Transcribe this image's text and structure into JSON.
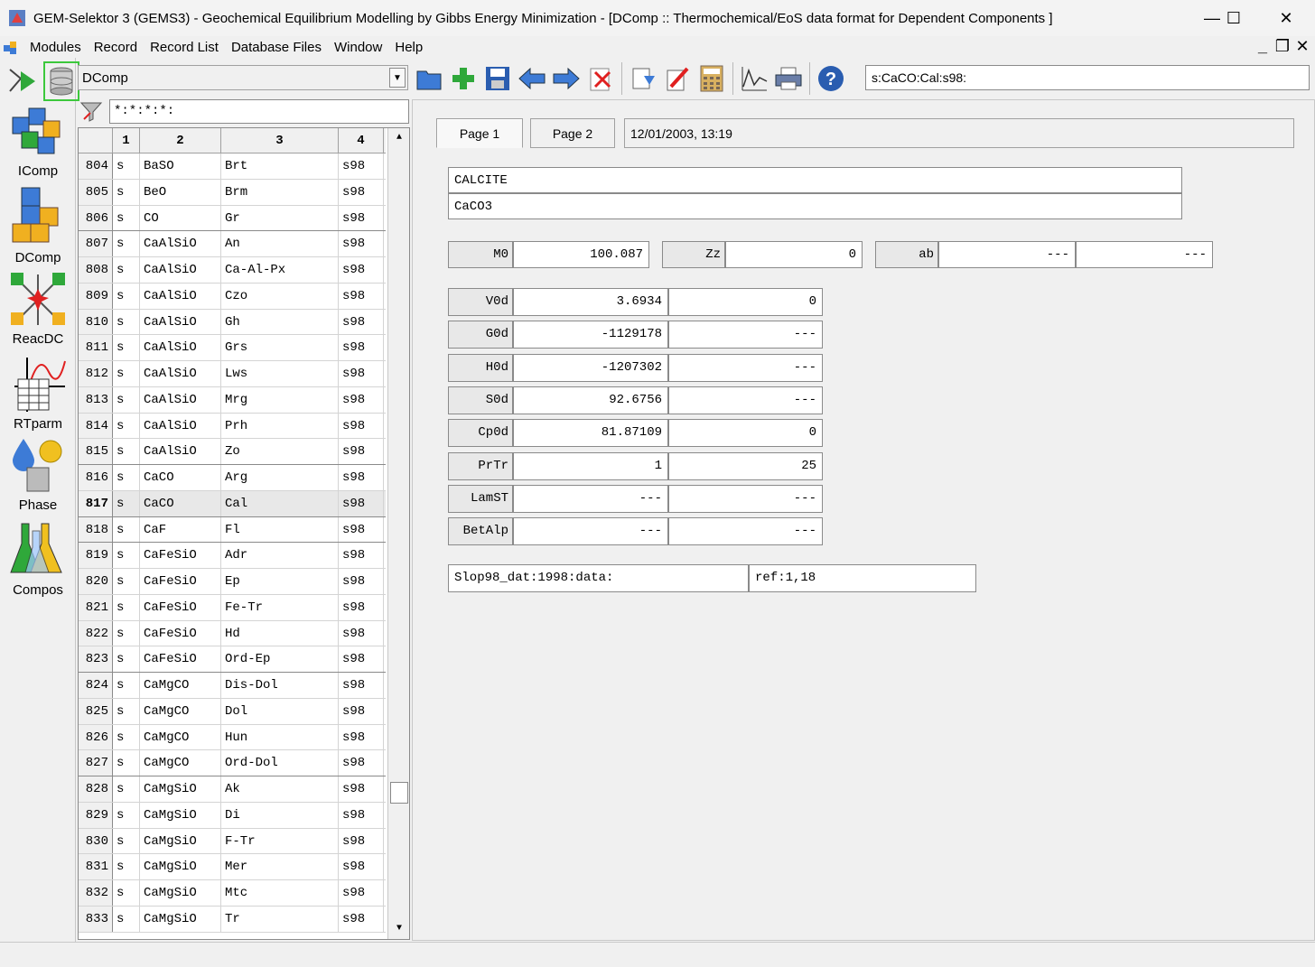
{
  "window": {
    "title": "GEM-Selektor 3 (GEMS3) - Geochemical Equilibrium Modelling by Gibbs Energy Minimization - [DComp ::  Thermochemical/EoS data format for Dependent Components ]",
    "minimize": "—",
    "maximize": "☐",
    "close": "✕"
  },
  "menu": [
    "Modules",
    "Record",
    "Record List",
    "Database Files",
    "Window",
    "Help"
  ],
  "modules": [
    {
      "label": "IComp"
    },
    {
      "label": "DComp"
    },
    {
      "label": "ReacDC"
    },
    {
      "label": "RTparm"
    },
    {
      "label": "Phase"
    },
    {
      "label": "Compos"
    }
  ],
  "module_selector": {
    "value": "DComp"
  },
  "filter": {
    "value": "*:*:*:*:"
  },
  "record_key": "s:CaCO:Cal:s98:",
  "table": {
    "headers": [
      "1",
      "2",
      "3",
      "4"
    ],
    "selected_index": "817",
    "rows": [
      {
        "n": "804",
        "c1": "s",
        "c2": "BaSO",
        "c3": "Brt",
        "c4": "s98"
      },
      {
        "n": "805",
        "c1": "s",
        "c2": "BeO",
        "c3": "Brm",
        "c4": "s98"
      },
      {
        "n": "806",
        "c1": "s",
        "c2": "CO",
        "c3": "Gr",
        "c4": "s98"
      },
      {
        "n": "807",
        "c1": "s",
        "c2": "CaAlSiO",
        "c3": "An",
        "c4": "s98"
      },
      {
        "n": "808",
        "c1": "s",
        "c2": "CaAlSiO",
        "c3": "Ca-Al-Px",
        "c4": "s98"
      },
      {
        "n": "809",
        "c1": "s",
        "c2": "CaAlSiO",
        "c3": "Czo",
        "c4": "s98"
      },
      {
        "n": "810",
        "c1": "s",
        "c2": "CaAlSiO",
        "c3": "Gh",
        "c4": "s98"
      },
      {
        "n": "811",
        "c1": "s",
        "c2": "CaAlSiO",
        "c3": "Grs",
        "c4": "s98"
      },
      {
        "n": "812",
        "c1": "s",
        "c2": "CaAlSiO",
        "c3": "Lws",
        "c4": "s98"
      },
      {
        "n": "813",
        "c1": "s",
        "c2": "CaAlSiO",
        "c3": "Mrg",
        "c4": "s98"
      },
      {
        "n": "814",
        "c1": "s",
        "c2": "CaAlSiO",
        "c3": "Prh",
        "c4": "s98"
      },
      {
        "n": "815",
        "c1": "s",
        "c2": "CaAlSiO",
        "c3": "Zo",
        "c4": "s98"
      },
      {
        "n": "816",
        "c1": "s",
        "c2": "CaCO",
        "c3": "Arg",
        "c4": "s98"
      },
      {
        "n": "817",
        "c1": "s",
        "c2": "CaCO",
        "c3": "Cal",
        "c4": "s98"
      },
      {
        "n": "818",
        "c1": "s",
        "c2": "CaF",
        "c3": "Fl",
        "c4": "s98"
      },
      {
        "n": "819",
        "c1": "s",
        "c2": "CaFeSiO",
        "c3": "Adr",
        "c4": "s98"
      },
      {
        "n": "820",
        "c1": "s",
        "c2": "CaFeSiO",
        "c3": "Ep",
        "c4": "s98"
      },
      {
        "n": "821",
        "c1": "s",
        "c2": "CaFeSiO",
        "c3": "Fe-Tr",
        "c4": "s98"
      },
      {
        "n": "822",
        "c1": "s",
        "c2": "CaFeSiO",
        "c3": "Hd",
        "c4": "s98"
      },
      {
        "n": "823",
        "c1": "s",
        "c2": "CaFeSiO",
        "c3": "Ord-Ep",
        "c4": "s98"
      },
      {
        "n": "824",
        "c1": "s",
        "c2": "CaMgCO",
        "c3": "Dis-Dol",
        "c4": "s98"
      },
      {
        "n": "825",
        "c1": "s",
        "c2": "CaMgCO",
        "c3": "Dol",
        "c4": "s98"
      },
      {
        "n": "826",
        "c1": "s",
        "c2": "CaMgCO",
        "c3": "Hun",
        "c4": "s98"
      },
      {
        "n": "827",
        "c1": "s",
        "c2": "CaMgCO",
        "c3": "Ord-Dol",
        "c4": "s98"
      },
      {
        "n": "828",
        "c1": "s",
        "c2": "CaMgSiO",
        "c3": "Ak",
        "c4": "s98"
      },
      {
        "n": "829",
        "c1": "s",
        "c2": "CaMgSiO",
        "c3": "Di",
        "c4": "s98"
      },
      {
        "n": "830",
        "c1": "s",
        "c2": "CaMgSiO",
        "c3": "F-Tr",
        "c4": "s98"
      },
      {
        "n": "831",
        "c1": "s",
        "c2": "CaMgSiO",
        "c3": "Mer",
        "c4": "s98"
      },
      {
        "n": "832",
        "c1": "s",
        "c2": "CaMgSiO",
        "c3": "Mtc",
        "c4": "s98"
      },
      {
        "n": "833",
        "c1": "s",
        "c2": "CaMgSiO",
        "c3": "Tr",
        "c4": "s98"
      }
    ]
  },
  "tabs": [
    {
      "label": "Page 1"
    },
    {
      "label": "Page 2"
    }
  ],
  "date": "12/01/2003, 13:19",
  "record": {
    "name": "CALCITE",
    "formula": "CaCO3",
    "M0": {
      "label": "M0",
      "value": "100.087"
    },
    "Zz": {
      "label": "Zz",
      "value": "0"
    },
    "ab": {
      "label": "ab",
      "v1": "---",
      "v2": "---"
    },
    "props": [
      {
        "label": "V0d",
        "v1": "3.6934",
        "v2": "0"
      },
      {
        "label": "G0d",
        "v1": "-1129178",
        "v2": "---"
      },
      {
        "label": "H0d",
        "v1": "-1207302",
        "v2": "---"
      },
      {
        "label": "S0d",
        "v1": "92.6756",
        "v2": "---"
      },
      {
        "label": "Cp0d",
        "v1": "81.87109",
        "v2": "0"
      },
      {
        "label": "PrTr",
        "v1": "1",
        "v2": "25"
      },
      {
        "label": "LamST",
        "v1": "---",
        "v2": "---"
      },
      {
        "label": "BetAlp",
        "v1": "---",
        "v2": "---"
      }
    ],
    "source": "Slop98_dat:1998:data:",
    "ref": "ref:1,18"
  }
}
